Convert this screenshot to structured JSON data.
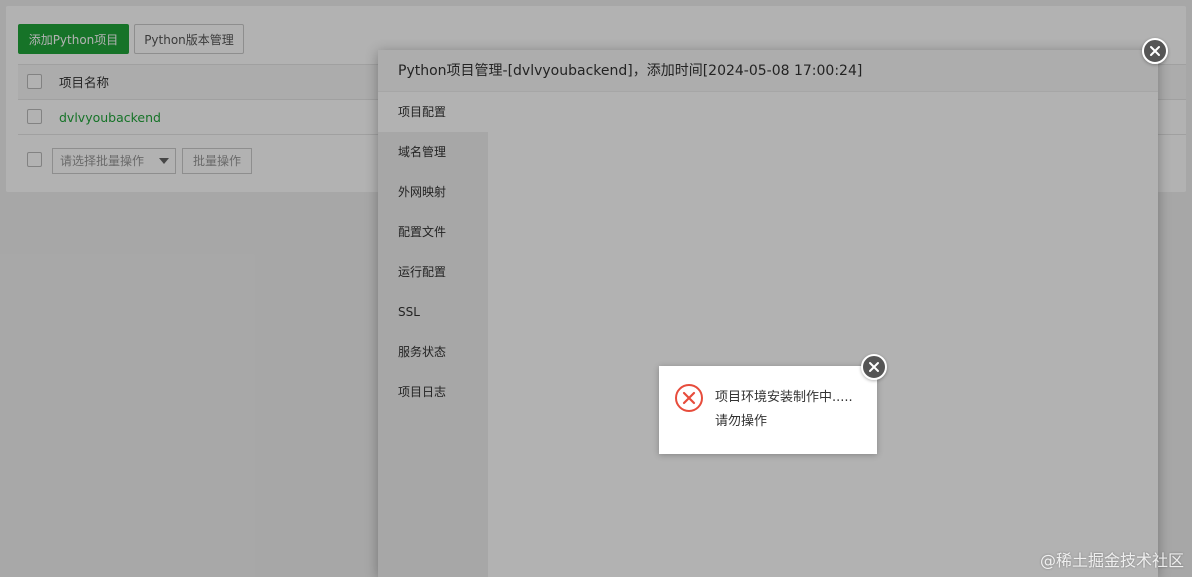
{
  "toolbar": {
    "add_label": "添加Python项目",
    "version_label": "Python版本管理"
  },
  "table": {
    "header": "项目名称",
    "rows": [
      "dvlvyoubackend"
    ]
  },
  "batch": {
    "select_placeholder": "请选择批量操作",
    "button_label": "批量操作"
  },
  "modal": {
    "title": "Python项目管理-[dvlvyoubackend]，添加时间[2024-05-08 17:00:24]",
    "menu": [
      "项目配置",
      "域名管理",
      "外网映射",
      "配置文件",
      "运行配置",
      "SSL",
      "服务状态",
      "项目日志"
    ],
    "active_index": 0
  },
  "alert": {
    "line1": "项目环境安装制作中.....",
    "line2": "请勿操作",
    "icon": "error-x-icon",
    "icon_color": "#e74c3c"
  },
  "watermark": "@稀土掘金技术社区",
  "colors": {
    "accent": "#20a53a"
  }
}
